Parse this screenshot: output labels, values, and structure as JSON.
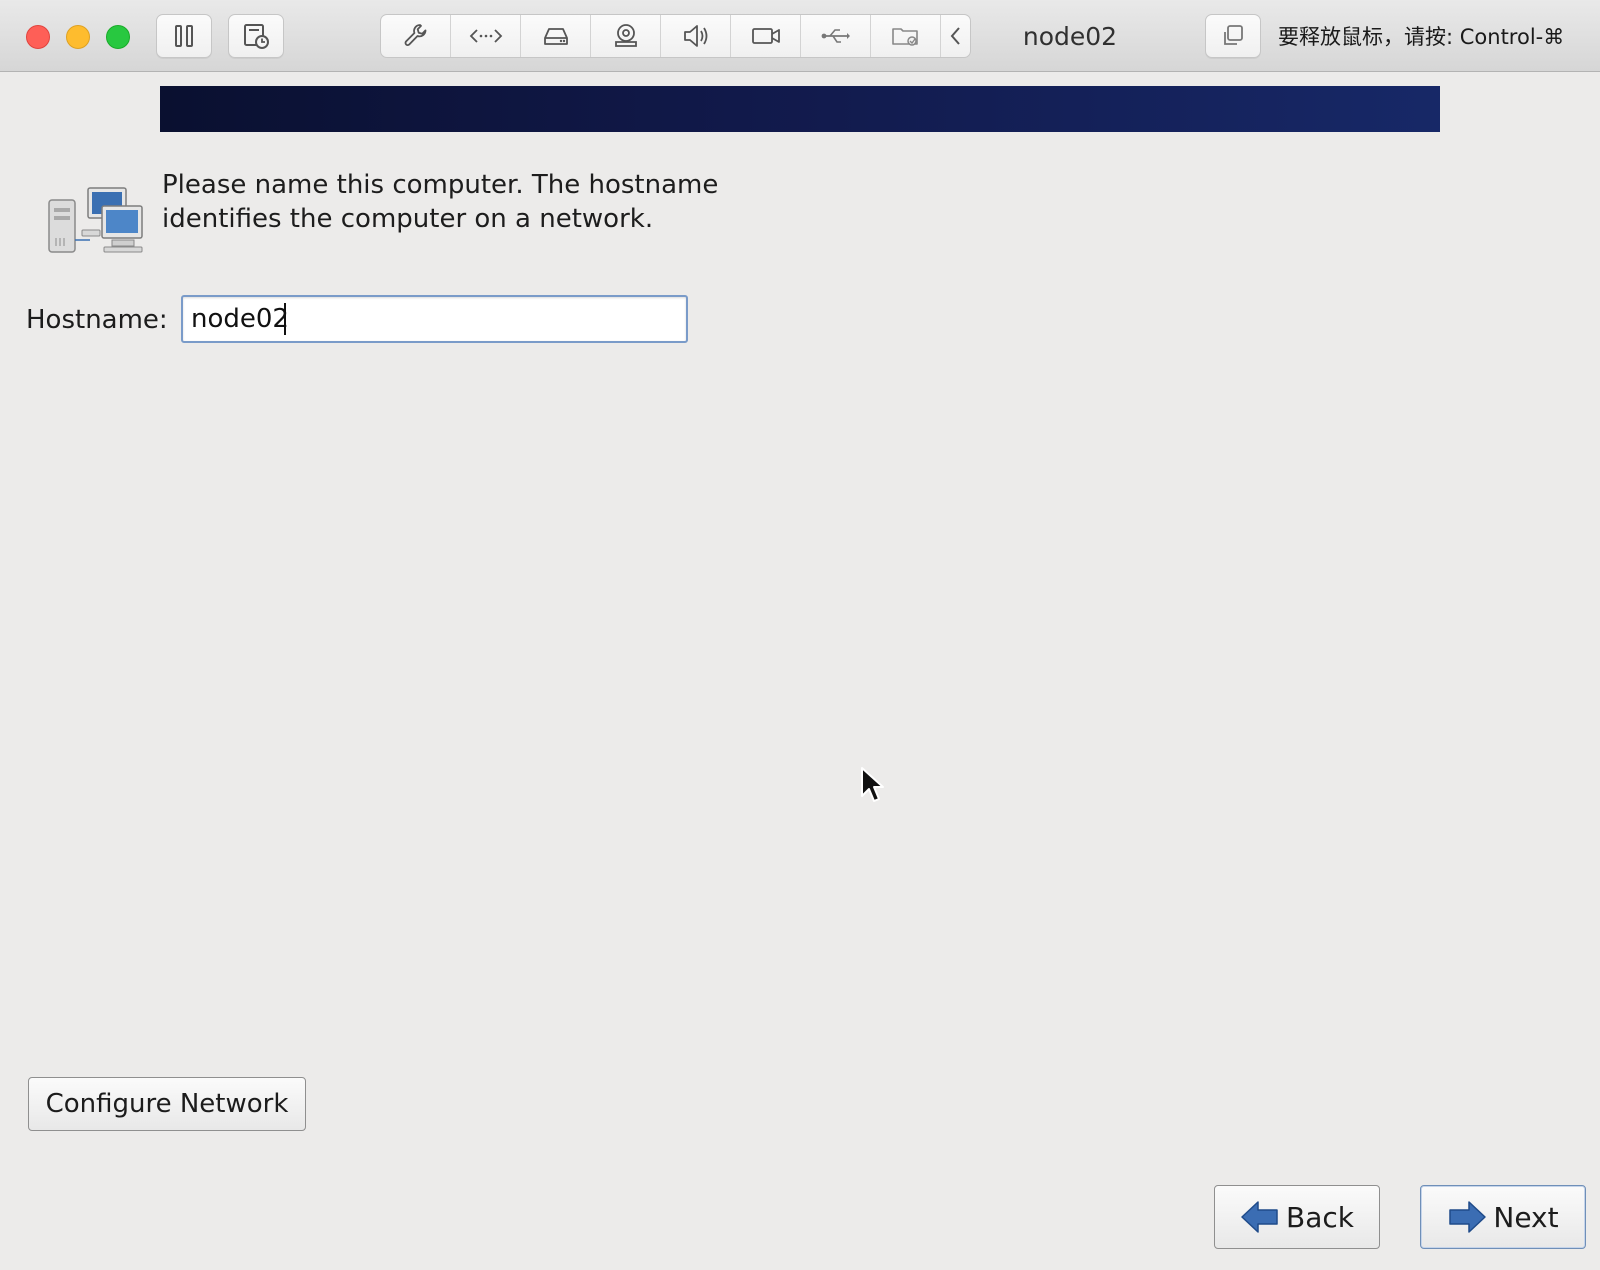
{
  "window": {
    "title": "node02",
    "release_hint": "要释放鼠标，请按: Control-⌘"
  },
  "toolbar": {
    "left_buttons": [
      "pause-icon",
      "snapshot-icon"
    ],
    "group": [
      "wrench-icon",
      "code-arrows-icon",
      "hard-disk-icon",
      "camera-disc-icon",
      "speaker-icon",
      "video-camera-icon",
      "usb-icon",
      "shared-folder-icon",
      "chevron-left-icon"
    ],
    "right_buttons": [
      "fullscreen-icon"
    ]
  },
  "installer": {
    "prompt": "Please name this computer.  The hostname identifies the computer on a network.",
    "hostname_label": "Hostname:",
    "hostname_value": "node02",
    "configure_network_label": "Configure Network",
    "back_label": "Back",
    "next_label": "Next"
  },
  "colors": {
    "banner_dark": "#0a1030",
    "banner_light": "#172867",
    "background": "#ecebea",
    "arrow_blue": "#3b6db3"
  }
}
